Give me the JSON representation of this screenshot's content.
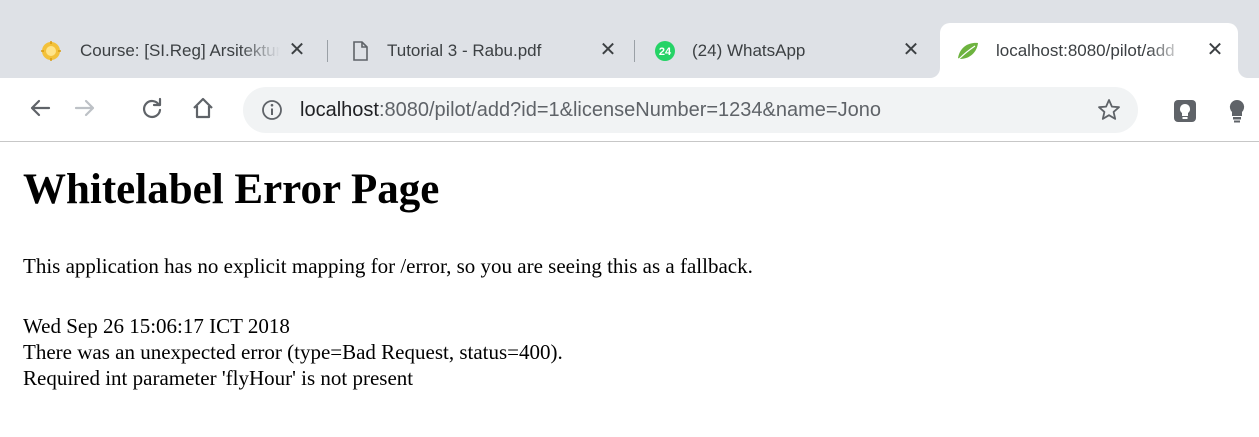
{
  "browser": {
    "tabs": [
      {
        "title": "Course: [SI.Reg] Arsitektur",
        "icon": "course-favicon-icon"
      },
      {
        "title": "Tutorial 3 - Rabu.pdf",
        "icon": "document-icon"
      },
      {
        "title": "(24) WhatsApp",
        "icon": "whatsapp-icon",
        "badge": "24"
      },
      {
        "title": "localhost:8080/pilot/add",
        "icon": "spring-leaf-icon",
        "active": true
      }
    ],
    "close_glyph": "✕",
    "address": {
      "host": "localhost",
      "rest": ":8080/pilot/add?id=1&licenseNumber=1234&name=Jono"
    },
    "colors": {
      "tabstrip": "#dee1e6",
      "omnibox": "#f1f3f4",
      "whatsapp": "#25d366",
      "spring": "#6db33f"
    }
  },
  "page": {
    "heading": "Whitelabel Error Page",
    "paragraph": "This application has no explicit mapping for /error, so you are seeing this as a fallback.",
    "timestamp": "Wed Sep 26 15:06:17 ICT 2018",
    "error_line": "There was an unexpected error (type=Bad Request, status=400).",
    "message": "Required int parameter 'flyHour' is not present"
  }
}
